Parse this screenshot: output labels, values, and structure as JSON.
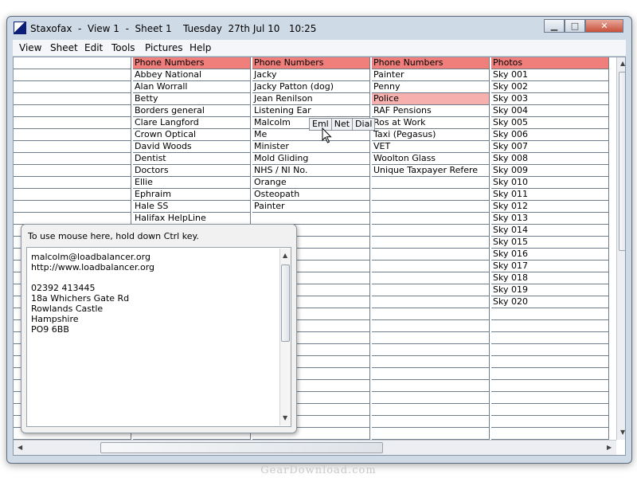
{
  "titlebar": {
    "title": "Staxofax  -  View 1  -  Sheet 1",
    "datetime": "Tuesday  27th Jul 10   10:25",
    "minimize": "▁",
    "maximize": "□",
    "close": "✕"
  },
  "menu": [
    "View",
    "Sheet",
    "Edit",
    "Tools",
    "Pictures",
    "Help"
  ],
  "columns": [
    {
      "header": "",
      "items": []
    },
    {
      "header": "Phone Numbers",
      "items": [
        "Abbey National",
        "Alan Worrall",
        "Betty",
        "Borders general",
        "Clare Langford",
        "Crown Optical",
        "David Woods",
        "Dentist",
        "Doctors",
        "Ellie",
        "Ephraim",
        "Hale SS",
        "Halifax HelpLine"
      ]
    },
    {
      "header": "Phone Numbers",
      "items": [
        "Jacky",
        "Jacky Patton (dog)",
        "Jean Renilson",
        "Listening Ear",
        "Malcolm",
        "Me",
        "Minister",
        "Mold Gliding",
        "NHS / NI No.",
        "Orange",
        "Osteopath",
        "Painter"
      ]
    },
    {
      "header": "Phone Numbers",
      "items": [
        "Painter",
        "Penny",
        "Police",
        "RAF Pensions",
        "Ros at Work",
        "Taxi (Pegasus)",
        "VET",
        "Woolton Glass",
        "Unique Taxpayer Refere"
      ]
    },
    {
      "header": "Photos",
      "items": [
        "Sky 001",
        "Sky 002",
        "Sky 003",
        "Sky 004",
        "Sky 005",
        "Sky 006",
        "Sky 007",
        "Sky 008",
        "Sky 009",
        "Sky 010",
        "Sky 011",
        "Sky 012",
        "Sky 013",
        "Sky 014",
        "Sky 015",
        "Sky 016",
        "Sky 017",
        "Sky 018",
        "Sky 019",
        "Sky 020"
      ]
    }
  ],
  "selected": {
    "column": 3,
    "row": 2
  },
  "context_menu": [
    "Eml",
    "Net",
    "Dial"
  ],
  "popup": {
    "hint": "To use mouse here, hold down Ctrl key.",
    "lines": [
      "malcolm@loadbalancer.org",
      "http://www.loadbalancer.org",
      "",
      "02392 413445",
      "18a Whichers Gate Rd",
      "Rowlands Castle",
      "Hampshire",
      "PO9 6BB"
    ]
  },
  "watermark": "GearDownload.com",
  "colors": {
    "header": "#f07f7c",
    "selected": "#f6b1ae",
    "grid": "#6f7c89"
  }
}
